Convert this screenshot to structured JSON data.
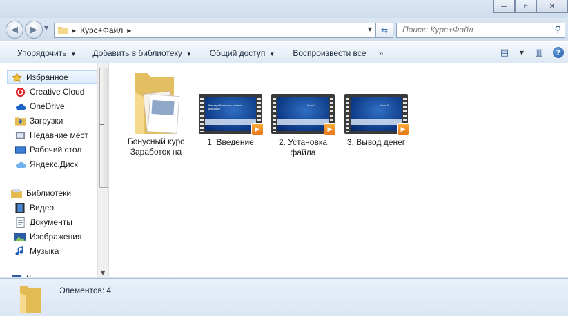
{
  "address": {
    "crumb": "Курс+Файл"
  },
  "search": {
    "placeholder": "Поиск: Курс+Файл"
  },
  "toolbar": {
    "organize": "Упорядочить",
    "add_library": "Добавить в библиотеку",
    "share": "Общий доступ",
    "play_all": "Воспроизвести все",
    "more": "»"
  },
  "sidebar": {
    "favorites": "Избранное",
    "items": [
      "Creative Cloud",
      "OneDrive",
      "Загрузки",
      "Недавние мест",
      "Рабочий стол",
      "Яндекс.Диск"
    ],
    "libraries": "Библиотеки",
    "lib_items": [
      "Видео",
      "Документы",
      "Изображения",
      "Музыка"
    ],
    "computer_partial": "К"
  },
  "files": [
    {
      "name": "Бонусный курс Заработок на",
      "type": "folder"
    },
    {
      "name": "1. Введение",
      "type": "video",
      "thumb_text": "Как заработать на сжатых архивах?"
    },
    {
      "name": "2. Установка файла",
      "type": "video",
      "thumb_text": "Урок 2"
    },
    {
      "name": "3. Вывод денег",
      "type": "video",
      "thumb_text": "Урок 3"
    }
  ],
  "status": {
    "count_text": "Элементов: 4"
  },
  "icons": {
    "back": "back-arrow-icon",
    "forward": "forward-arrow-icon",
    "refresh": "refresh-icon",
    "search": "search-icon",
    "view": "view-icon",
    "preview": "preview-pane-icon",
    "help": "help-icon"
  }
}
